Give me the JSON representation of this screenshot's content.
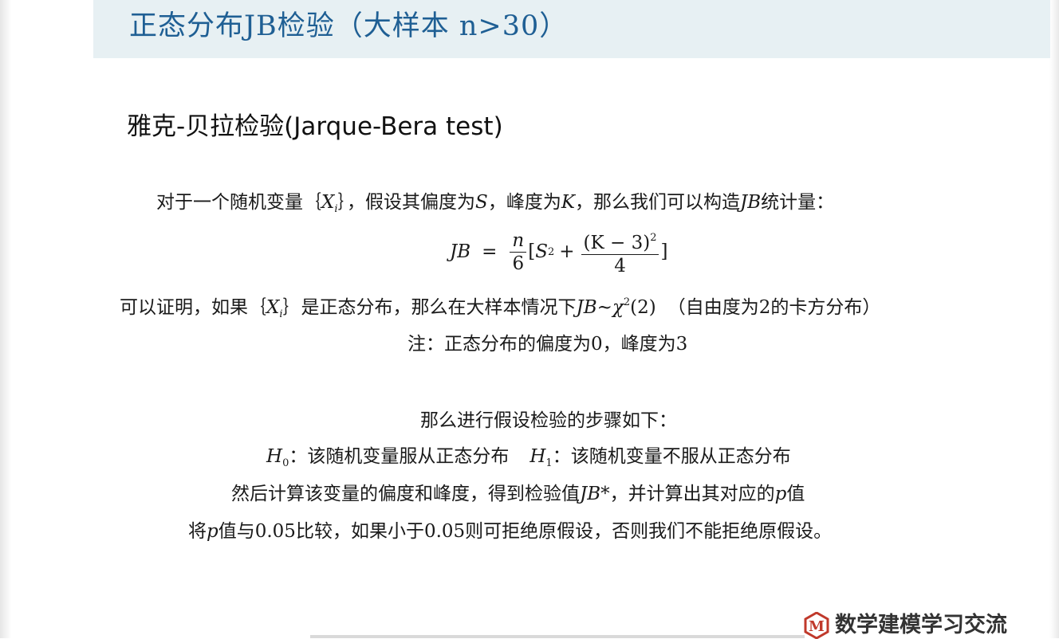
{
  "slide": {
    "title": "正态分布JB检验（大样本 n>30）",
    "heading": "雅克-贝拉检验(Jarque-Bera test)"
  },
  "body": {
    "intro": {
      "p1": "对于一个随机变量｛",
      "var": "X",
      "var_sub": "i",
      "p2": "｝，假设其偏度为",
      "S": "S",
      "p3": "，峰度为",
      "K": "K",
      "p4": "，那么我们可以构造",
      "JB": "JB",
      "p5": "统计量："
    },
    "formula": {
      "lhs": "JB",
      "eq": "=",
      "n": "n",
      "six": "6",
      "open": "[",
      "S": "S",
      "sq": "2",
      "plus": "+",
      "k_num": "(K − 3)",
      "k_sq": "2",
      "four": "4",
      "close": "]"
    },
    "proof": {
      "p1": "可以证明，如果｛",
      "var": "X",
      "var_sub": "i",
      "p2": "｝是正态分布，那么在大样本情况下",
      "JB": "JB",
      "tilde": "~",
      "chi": "χ",
      "chi_sup": "2",
      "chi_arg": "(2)",
      "p3": "（自由度为2的卡方分布）"
    },
    "note": "注：正态分布的偏度为0，峰度为3",
    "steps_intro": "那么进行假设检验的步骤如下：",
    "hypotheses": {
      "H": "H",
      "h0_sub": "0",
      "h0_text": "：该随机变量服从正态分布",
      "h1_sub": "1",
      "h1_text": "：该随机变量不服从正态分布"
    },
    "compute": {
      "p1": "然后计算该变量的偏度和峰度，得到检验值",
      "JB": "JB*",
      "p2": "，并计算出其对应的",
      "p": "p",
      "p3": "值"
    },
    "decision": {
      "p1": "将",
      "p": "p",
      "p2": "值与0.05比较，如果小于0.05则可拒绝原假设，否则我们不能拒绝原假设。"
    }
  },
  "watermark": {
    "badge_letter": "M",
    "text": "数学建模学习交流"
  },
  "colors": {
    "title": "#1f5f94",
    "title_band": "#e7f0f3",
    "logo_red": "#c0392b"
  }
}
